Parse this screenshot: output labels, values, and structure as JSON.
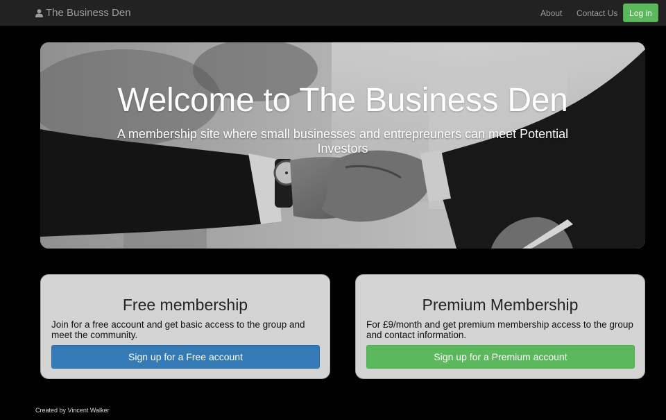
{
  "nav": {
    "brand": "The Business Den",
    "brand_icon": "user-icon",
    "links": [
      "About",
      "Contact Us"
    ],
    "login_label": "Log in"
  },
  "hero": {
    "title": "Welcome to The Business Den",
    "subtitle": "A membership site where small businesses and entrepreuners can meet Potential Investors",
    "image": "handshake-photo"
  },
  "cards": {
    "free": {
      "title": "Free membership",
      "text": "Join for a free account and get basic access to the group and meet the community.",
      "button": "Sign up for a Free account"
    },
    "premium": {
      "title": "Premium Membership",
      "text": "For £9/month and get premium membership access to the group and contact information.",
      "button": "Sign up for a Premium account"
    }
  },
  "footer": {
    "text": "Created by Vincent Walker"
  },
  "colors": {
    "navbar": "#222222",
    "primary": "#337ab7",
    "success": "#5cb85c",
    "card": "#d4d4d4",
    "background": "#000000"
  }
}
